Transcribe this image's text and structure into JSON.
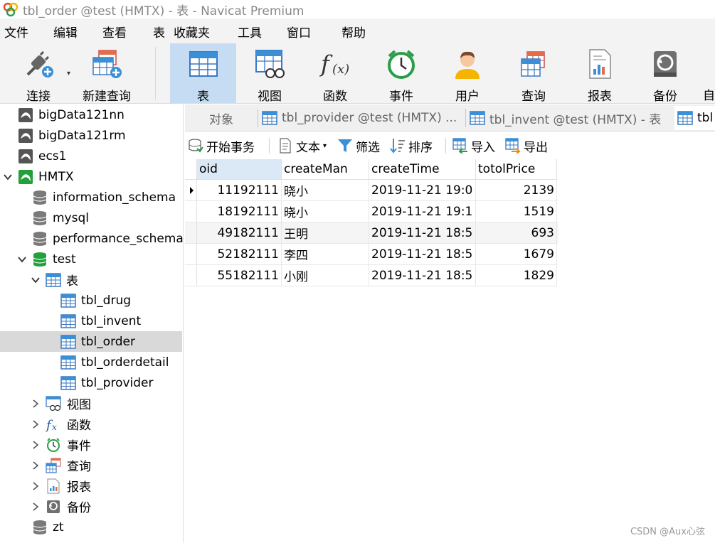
{
  "window": {
    "title": "tbl_order @test (HMTX) - 表 - Navicat Premium"
  },
  "menu": [
    "文件",
    "编辑",
    "查看",
    "表",
    "收藏夹",
    "工具",
    "窗口",
    "帮助"
  ],
  "toolbar": {
    "connect": "连接",
    "new_query": "新建查询",
    "table": "表",
    "view": "视图",
    "function": "函数",
    "event": "事件",
    "user": "用户",
    "query": "查询",
    "report": "报表",
    "backup": "备份",
    "auto": "自"
  },
  "sidebar": {
    "connections": [
      {
        "label": "bigData121nn"
      },
      {
        "label": "bigData121rm"
      },
      {
        "label": "ecs1"
      },
      {
        "label": "HMTX"
      }
    ],
    "hmtx_databases": [
      {
        "label": "information_schema"
      },
      {
        "label": "mysql"
      },
      {
        "label": "performance_schema"
      },
      {
        "label": "test"
      }
    ],
    "test_children": {
      "tables_group": "表",
      "tables": [
        "tbl_drug",
        "tbl_invent",
        "tbl_order",
        "tbl_orderdetail",
        "tbl_provider"
      ],
      "selected_table": "tbl_order",
      "groups": [
        "视图",
        "函数",
        "事件",
        "查询",
        "报表",
        "备份"
      ]
    },
    "zt": "zt"
  },
  "tabs": {
    "objects": "对象",
    "tab1": "tbl_provider @test (HMTX) ...",
    "tab2": "tbl_invent @test (HMTX) - 表",
    "tab3": "tbl"
  },
  "subtoolbar": {
    "begin_transaction": "开始事务",
    "text": "文本",
    "filter": "筛选",
    "sort": "排序",
    "import": "导入",
    "export": "导出"
  },
  "grid": {
    "columns": [
      "oid",
      "createMan",
      "createTime",
      "totolPrice"
    ],
    "rows": [
      [
        "11192111",
        "晓小",
        "2019-11-21 19:0",
        "2139"
      ],
      [
        "18192111",
        "晓小",
        "2019-11-21 19:1",
        "1519"
      ],
      [
        "49182111",
        "王明",
        "2019-11-21 18:5",
        "693"
      ],
      [
        "52182111",
        "李四",
        "2019-11-21 18:5",
        "1679"
      ],
      [
        "55182111",
        "小刚",
        "2019-11-21 18:5",
        "1829"
      ]
    ]
  },
  "watermark": "CSDN @Aux心弦",
  "colors": {
    "accent": "#3a8fd6",
    "selection": "#d9d9d9",
    "active_tool": "#c6dcf2",
    "db_green": "#22a03a"
  }
}
